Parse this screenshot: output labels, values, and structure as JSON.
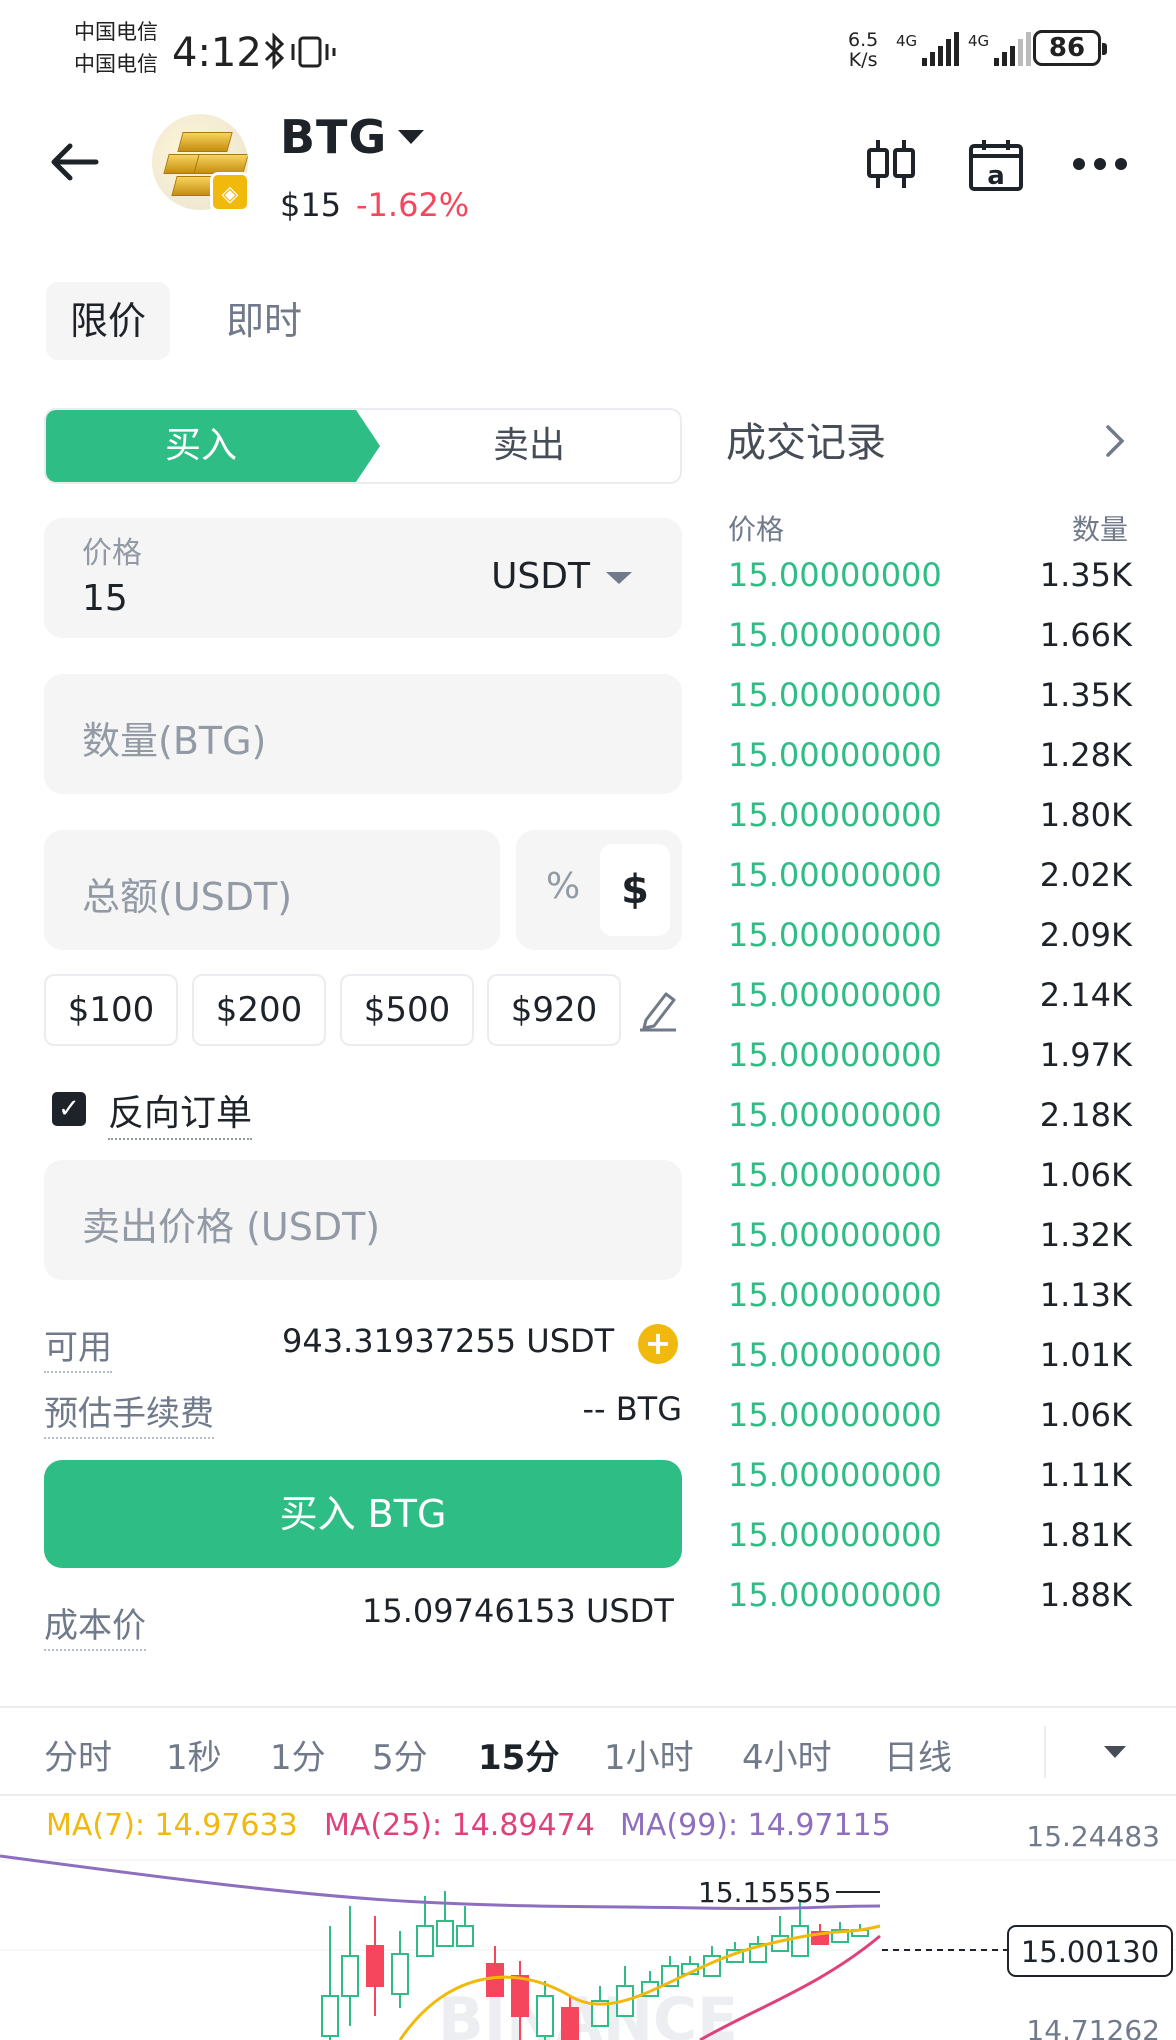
{
  "status_bar": {
    "carrier1": "中国电信",
    "carrier2": "中国电信",
    "time": "4:12",
    "net_speed_value": "6.5",
    "net_speed_unit": "K/s",
    "sig1_label": "4G",
    "sig2_label": "4G",
    "battery": "86"
  },
  "header": {
    "symbol": "BTG",
    "price": "$15",
    "change": "-1.62%",
    "change_color": "#f6465d"
  },
  "order_types": [
    "限价",
    "即时"
  ],
  "side_tabs": {
    "buy": "买入",
    "sell": "卖出"
  },
  "form": {
    "price_label": "价格",
    "price_value": "15",
    "price_currency": "USDT",
    "quantity_placeholder": "数量(BTG)",
    "total_placeholder": "总额(USDT)",
    "toggle_percent": "%",
    "toggle_dollar": "$",
    "quick_amounts": [
      "$100",
      "$200",
      "$500",
      "$920"
    ],
    "reverse_order_label": "反向订单",
    "reverse_order_checked": true,
    "sell_price_placeholder": "卖出价格 (USDT)",
    "available_label": "可用",
    "available_value": "943.31937255 USDT",
    "fee_label": "预估手续费",
    "fee_value": "-- BTG",
    "buy_button": "买入 BTG",
    "cost_label": "成本价",
    "cost_value": "15.09746153 USDT"
  },
  "trades": {
    "title": "成交记录",
    "col_price": "价格",
    "col_qty": "数量",
    "rows": [
      {
        "price": "15.00000000",
        "qty": "1.35K"
      },
      {
        "price": "15.00000000",
        "qty": "1.66K"
      },
      {
        "price": "15.00000000",
        "qty": "1.35K"
      },
      {
        "price": "15.00000000",
        "qty": "1.28K"
      },
      {
        "price": "15.00000000",
        "qty": "1.80K"
      },
      {
        "price": "15.00000000",
        "qty": "2.02K"
      },
      {
        "price": "15.00000000",
        "qty": "2.09K"
      },
      {
        "price": "15.00000000",
        "qty": "2.14K"
      },
      {
        "price": "15.00000000",
        "qty": "1.97K"
      },
      {
        "price": "15.00000000",
        "qty": "2.18K"
      },
      {
        "price": "15.00000000",
        "qty": "1.06K"
      },
      {
        "price": "15.00000000",
        "qty": "1.32K"
      },
      {
        "price": "15.00000000",
        "qty": "1.13K"
      },
      {
        "price": "15.00000000",
        "qty": "1.01K"
      },
      {
        "price": "15.00000000",
        "qty": "1.06K"
      },
      {
        "price": "15.00000000",
        "qty": "1.11K"
      },
      {
        "price": "15.00000000",
        "qty": "1.81K"
      },
      {
        "price": "15.00000000",
        "qty": "1.88K"
      }
    ]
  },
  "chart": {
    "intervals": [
      "分时",
      "1秒",
      "1分",
      "5分",
      "15分",
      "1小时",
      "4小时",
      "日线"
    ],
    "active_interval": "15分",
    "ma7": "MA(7): 14.97633",
    "ma25": "MA(25): 14.89474",
    "ma99": "MA(99): 14.97115",
    "ma7_color": "#f0b90b",
    "ma25_color": "#e0407b",
    "ma99_color": "#8e6fbf",
    "high_label": "15.24483",
    "peak_label": "15.15555",
    "current_label": "15.00130",
    "low_label": "14.71262",
    "watermark": "BINANCE"
  }
}
